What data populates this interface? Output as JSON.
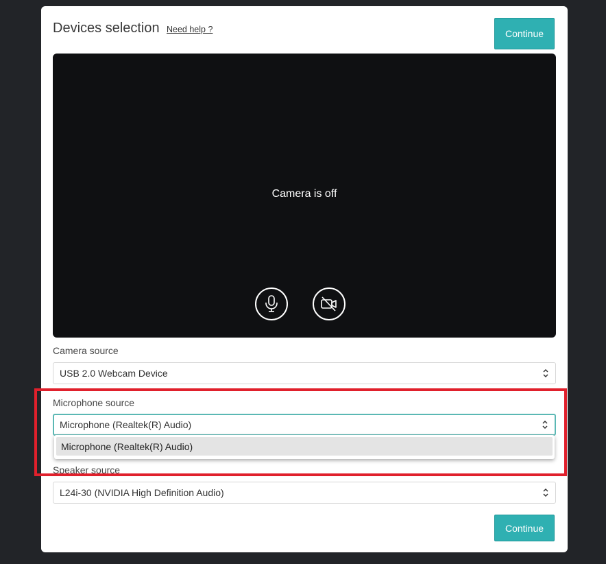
{
  "dialog": {
    "title": "Devices selection",
    "help_link": "Need help ?",
    "continue_top": "Continue",
    "continue_bottom": "Continue"
  },
  "preview": {
    "status": "Camera is off",
    "mic_icon": "microphone-icon",
    "camera_icon": "camera-off-icon"
  },
  "camera_source": {
    "label": "Camera source",
    "value": "USB 2.0 Webcam Device"
  },
  "microphone_source": {
    "label": "Microphone source",
    "value": "Microphone (Realtek(R) Audio)",
    "options": [
      "Microphone (Realtek(R) Audio)"
    ]
  },
  "speaker_source": {
    "label": "Speaker source",
    "value": "L24i-30 (NVIDIA High Definition Audio)"
  },
  "colors": {
    "accent": "#2fb0b2",
    "background": "#222428",
    "highlight": "#e0202c"
  }
}
